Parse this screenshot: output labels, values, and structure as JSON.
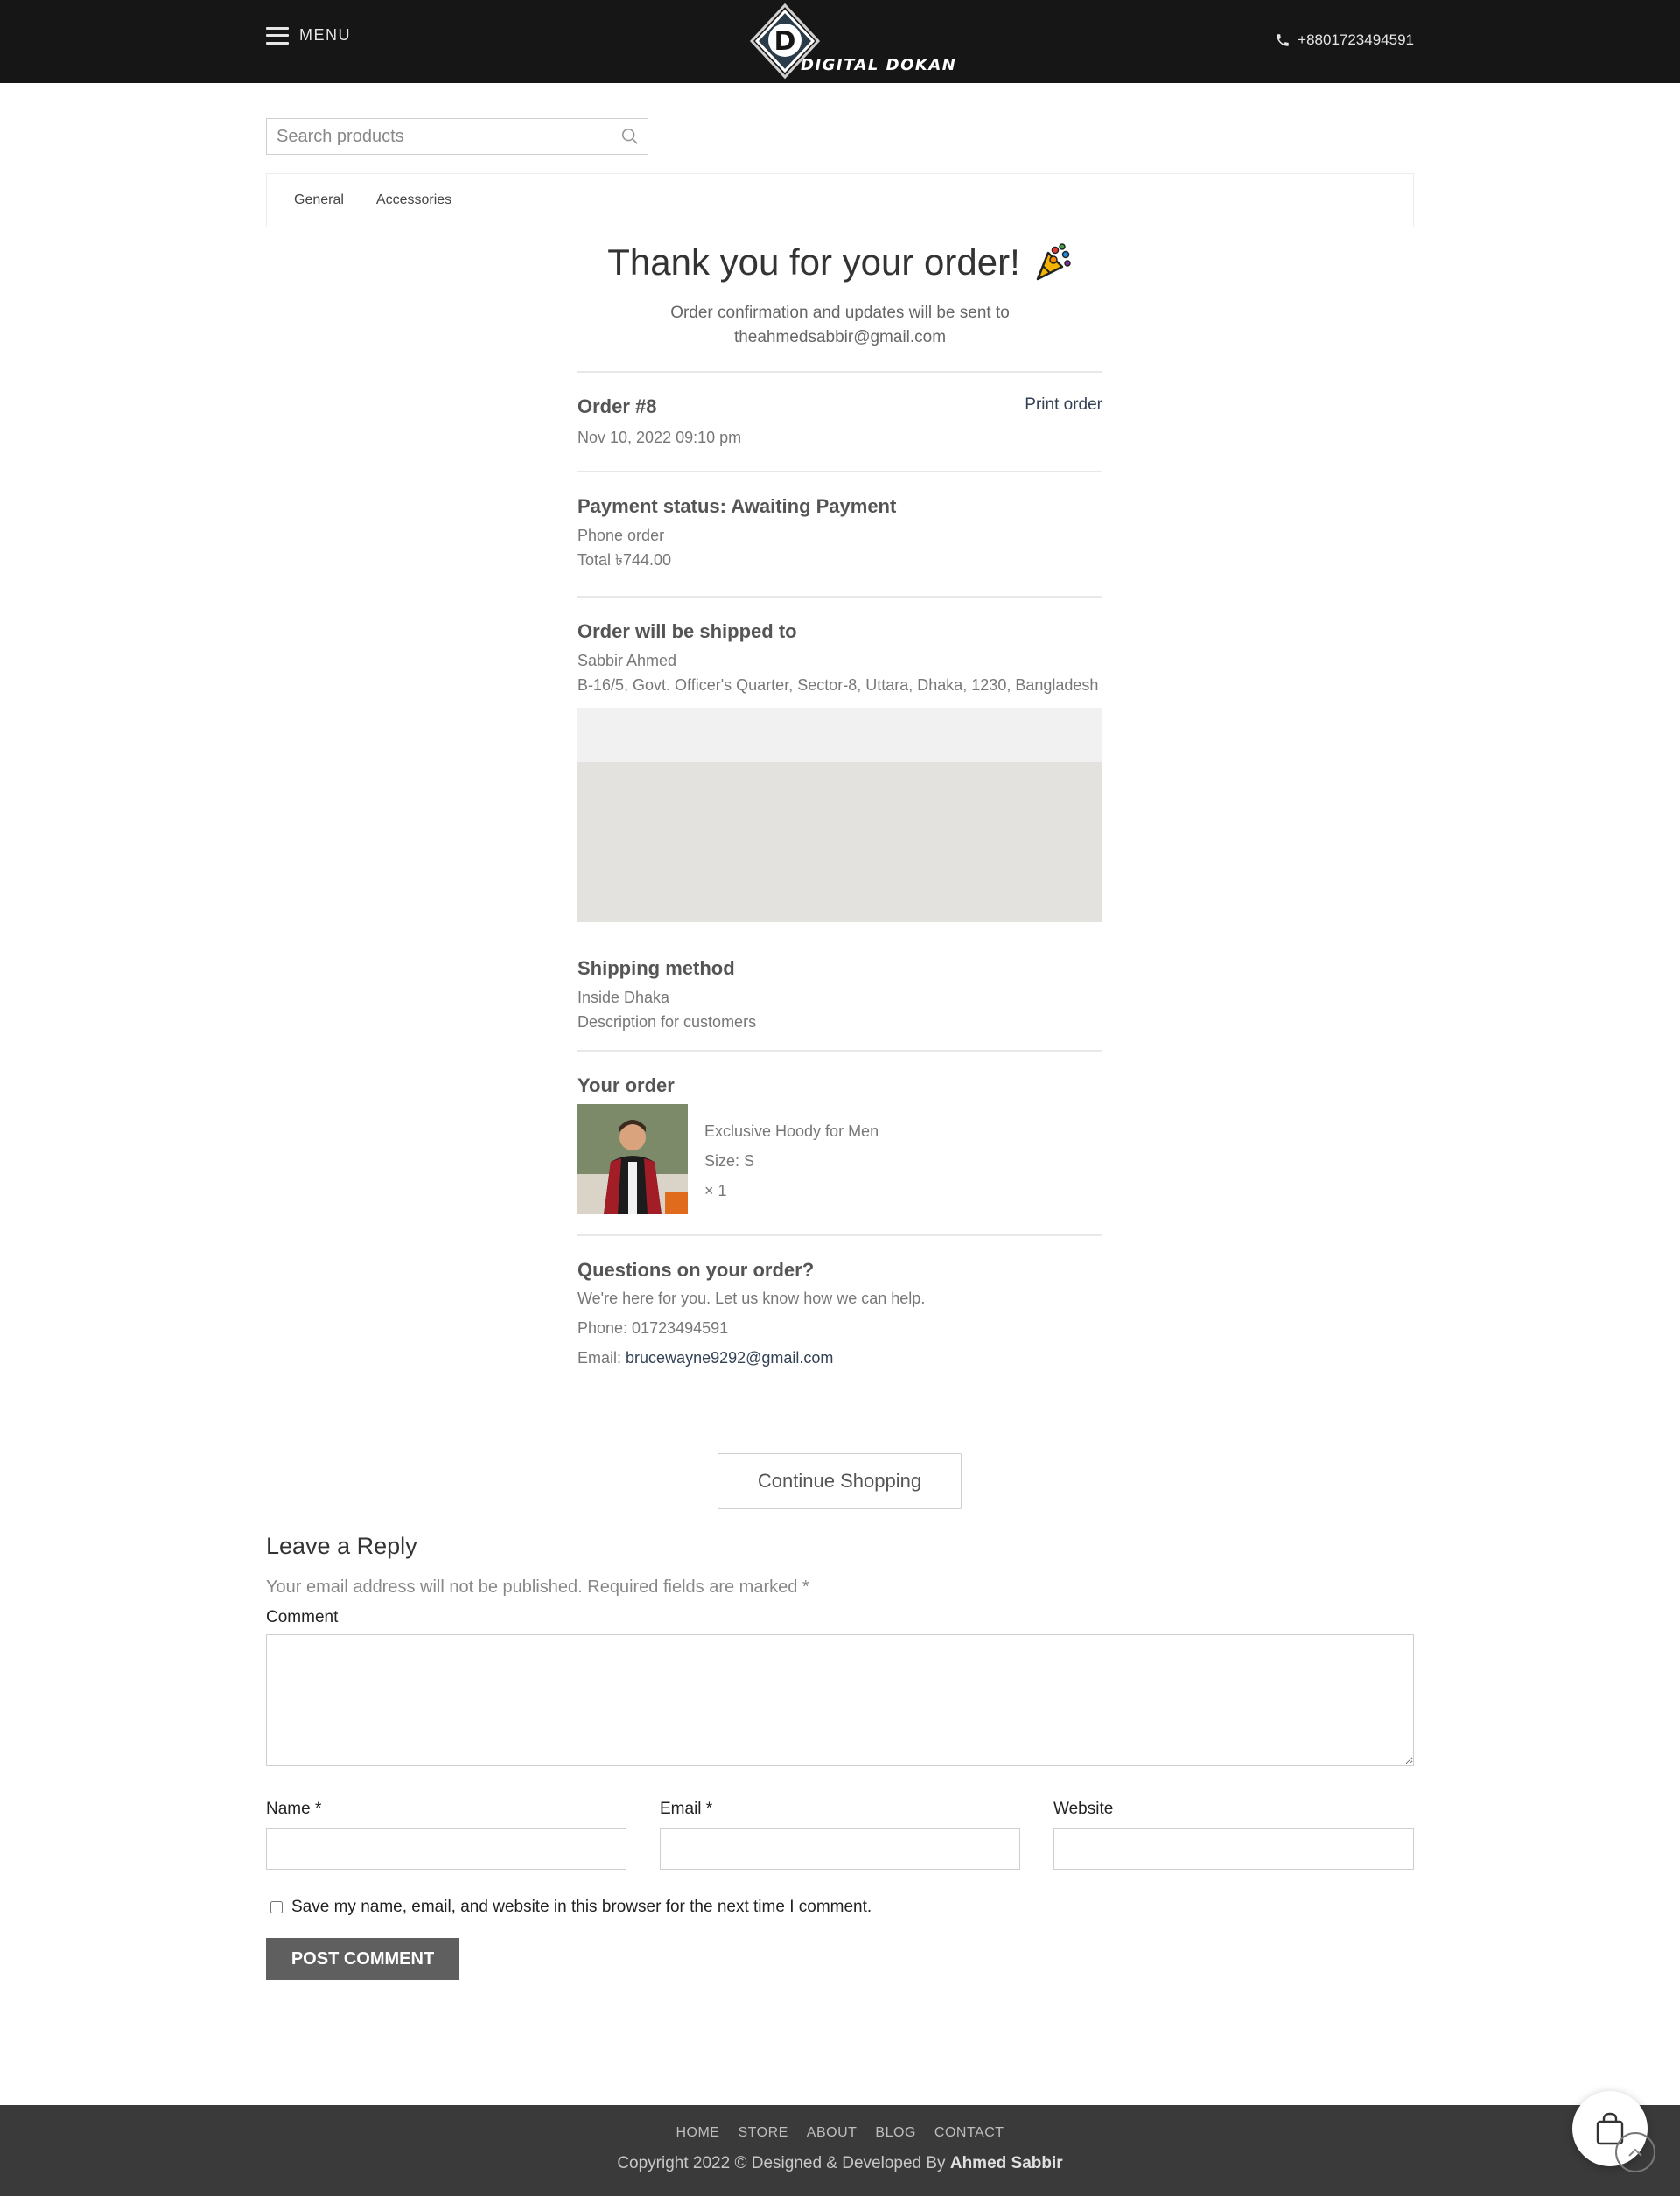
{
  "header": {
    "menu_label": "MENU",
    "logo_text": "DIGITAL DOKAN",
    "logo_letter": "D",
    "phone": "+8801723494591"
  },
  "search": {
    "placeholder": "Search products"
  },
  "categories": [
    "General",
    "Accessories"
  ],
  "confirmation": {
    "title": "Thank you for your order!",
    "subtitle": "Order confirmation and updates will be sent to",
    "email": "theahmedsabbir@gmail.com"
  },
  "order": {
    "number": "Order #8",
    "print_label": "Print order",
    "date": "Nov 10, 2022 09:10 pm"
  },
  "payment": {
    "status": "Payment status: Awaiting Payment",
    "method": "Phone order",
    "total_label": "Total",
    "total_value": "৳744.00"
  },
  "shipping": {
    "title": "Order will be shipped to",
    "name": "Sabbir Ahmed",
    "address": "B-16/5, Govt. Officer's Quarter, Sector-8, Uttara, Dhaka, 1230, Bangladesh"
  },
  "shipping_method": {
    "title": "Shipping method",
    "name": "Inside Dhaka",
    "description": "Description for customers"
  },
  "your_order": {
    "title": "Your order",
    "item_name": "Exclusive Hoody for Men",
    "item_size": "Size: S",
    "item_qty": "× 1"
  },
  "questions": {
    "title": "Questions on your order?",
    "text": "We're here for you. Let us know how we can help.",
    "phone": "Phone: 01723494591",
    "email_label": "Email:",
    "email": "brucewayne9292@gmail.com"
  },
  "continue_label": "Continue Shopping",
  "reply": {
    "title": "Leave a Reply",
    "note": "Your email address will not be published. Required fields are marked *",
    "comment_label": "Comment",
    "name_label": "Name *",
    "email_label": "Email *",
    "website_label": "Website",
    "save_label": "Save my name, email, and website in this browser for the next time I comment.",
    "post_label": "POST COMMENT"
  },
  "footer": {
    "nav": [
      "HOME",
      "STORE",
      "ABOUT",
      "BLOG",
      "CONTACT"
    ],
    "copyright": "Copyright 2022 © Designed & Developed By",
    "author": "Ahmed Sabbir"
  },
  "colors": {
    "header_bg": "#161616",
    "footer_bg": "#3a3a3a",
    "link": "#334155",
    "post_button": "#5f5f5f"
  }
}
